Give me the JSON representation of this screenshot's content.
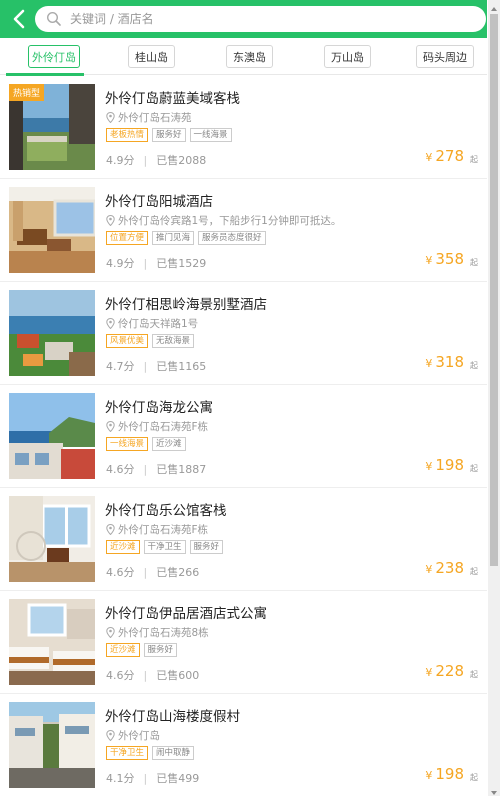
{
  "search": {
    "placeholder": "关键词 / 酒店名"
  },
  "tabs": [
    {
      "label": "外伶仃岛",
      "active": true
    },
    {
      "label": "桂山岛",
      "active": false
    },
    {
      "label": "东澳岛",
      "active": false
    },
    {
      "label": "万山岛",
      "active": false
    },
    {
      "label": "码头周边",
      "active": false
    }
  ],
  "hotels": [
    {
      "badge": "热销型",
      "name": "外伶仃岛蔚蓝美域客栈",
      "address": "外伶仃岛石涛苑",
      "tags": [
        {
          "text": "老板热情",
          "hl": true
        },
        {
          "text": "服务好",
          "hl": false
        },
        {
          "text": "一线海景",
          "hl": false
        }
      ],
      "score": "4.9分",
      "sold": "已售2088",
      "currency": "¥",
      "price": "278",
      "qi": "起"
    },
    {
      "name": "外伶仃岛阳城酒店",
      "address": "外伶仃岛伶宾路1号，下船步行1分钟即可抵达。",
      "tags": [
        {
          "text": "位置方便",
          "hl": true
        },
        {
          "text": "推门见海",
          "hl": false
        },
        {
          "text": "服务员态度很好",
          "hl": false
        }
      ],
      "score": "4.9分",
      "sold": "已售1529",
      "currency": "¥",
      "price": "358",
      "qi": "起"
    },
    {
      "name": "外伶仃相思岭海景别墅酒店",
      "address": "伶仃岛天祥路1号",
      "tags": [
        {
          "text": "风景优美",
          "hl": true
        },
        {
          "text": "无敌海景",
          "hl": false
        }
      ],
      "score": "4.7分",
      "sold": "已售1165",
      "currency": "¥",
      "price": "318",
      "qi": "起"
    },
    {
      "name": "外伶仃岛海龙公寓",
      "address": "外伶仃岛石涛苑F栋",
      "tags": [
        {
          "text": "一线海景",
          "hl": true
        },
        {
          "text": "近沙滩",
          "hl": false
        }
      ],
      "score": "4.6分",
      "sold": "已售1887",
      "currency": "¥",
      "price": "198",
      "qi": "起"
    },
    {
      "name": "外伶仃岛乐公馆客栈",
      "address": "外伶仃岛石涛苑F栋",
      "tags": [
        {
          "text": "近沙滩",
          "hl": true
        },
        {
          "text": "干净卫生",
          "hl": false
        },
        {
          "text": "服务好",
          "hl": false
        }
      ],
      "score": "4.6分",
      "sold": "已售266",
      "currency": "¥",
      "price": "238",
      "qi": "起"
    },
    {
      "name": "外伶仃岛伊品居酒店式公寓",
      "address": "外伶仃岛石涛苑8栋",
      "tags": [
        {
          "text": "近沙滩",
          "hl": true
        },
        {
          "text": "服务好",
          "hl": false
        }
      ],
      "score": "4.6分",
      "sold": "已售600",
      "currency": "¥",
      "price": "228",
      "qi": "起"
    },
    {
      "name": "外伶仃岛山海楼度假村",
      "address": "外伶仃岛",
      "tags": [
        {
          "text": "干净卫生",
          "hl": true
        },
        {
          "text": "闹中取静",
          "hl": false
        }
      ],
      "score": "4.1分",
      "sold": "已售499",
      "currency": "¥",
      "price": "198",
      "qi": "起"
    }
  ]
}
